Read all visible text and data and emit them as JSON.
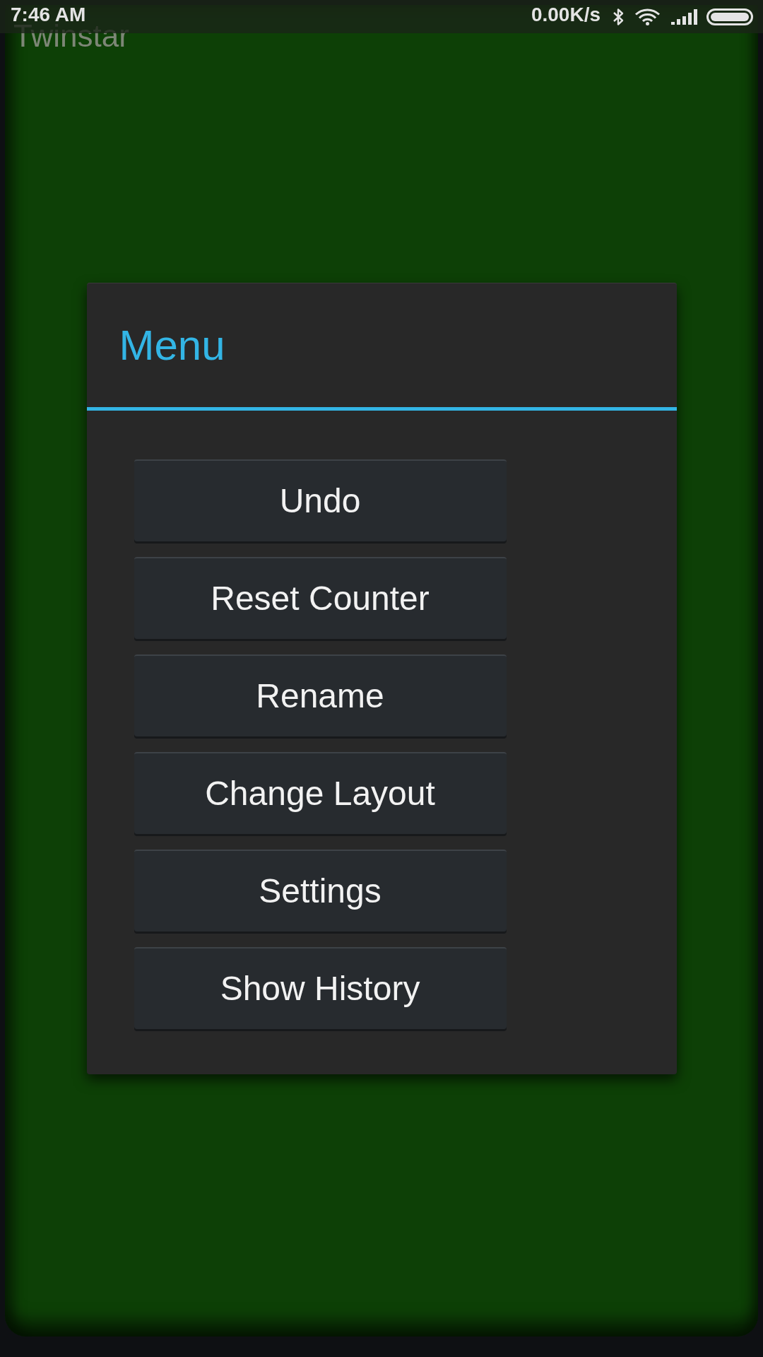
{
  "status_bar": {
    "time": "7:46 AM",
    "net_speed": "0.00K/s"
  },
  "app": {
    "title": "Twinstar"
  },
  "dialog": {
    "title": "Menu",
    "buttons": [
      "Undo",
      "Reset Counter",
      "Rename",
      "Change Layout",
      "Settings",
      "Show History"
    ]
  }
}
